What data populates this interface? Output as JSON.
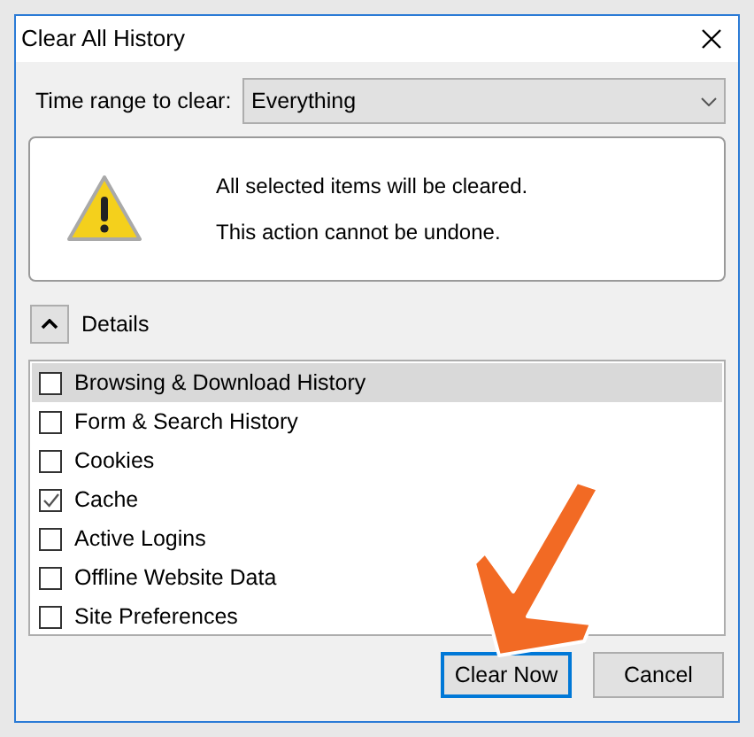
{
  "window": {
    "title": "Clear All History"
  },
  "time_range": {
    "label": "Time range to clear:",
    "value": "Everything"
  },
  "warning": {
    "lines": [
      "All selected items will be cleared.",
      "This action cannot be undone."
    ]
  },
  "details": {
    "label": "Details",
    "expanded": true
  },
  "items": [
    {
      "label": "Browsing & Download History",
      "checked": false,
      "selected": true
    },
    {
      "label": "Form & Search History",
      "checked": false,
      "selected": false
    },
    {
      "label": "Cookies",
      "checked": false,
      "selected": false
    },
    {
      "label": "Cache",
      "checked": true,
      "selected": false
    },
    {
      "label": "Active Logins",
      "checked": false,
      "selected": false
    },
    {
      "label": "Offline Website Data",
      "checked": false,
      "selected": false
    },
    {
      "label": "Site Preferences",
      "checked": false,
      "selected": false
    }
  ],
  "buttons": [
    {
      "label": "Clear Now",
      "focused": true
    },
    {
      "label": "Cancel",
      "focused": false
    }
  ]
}
